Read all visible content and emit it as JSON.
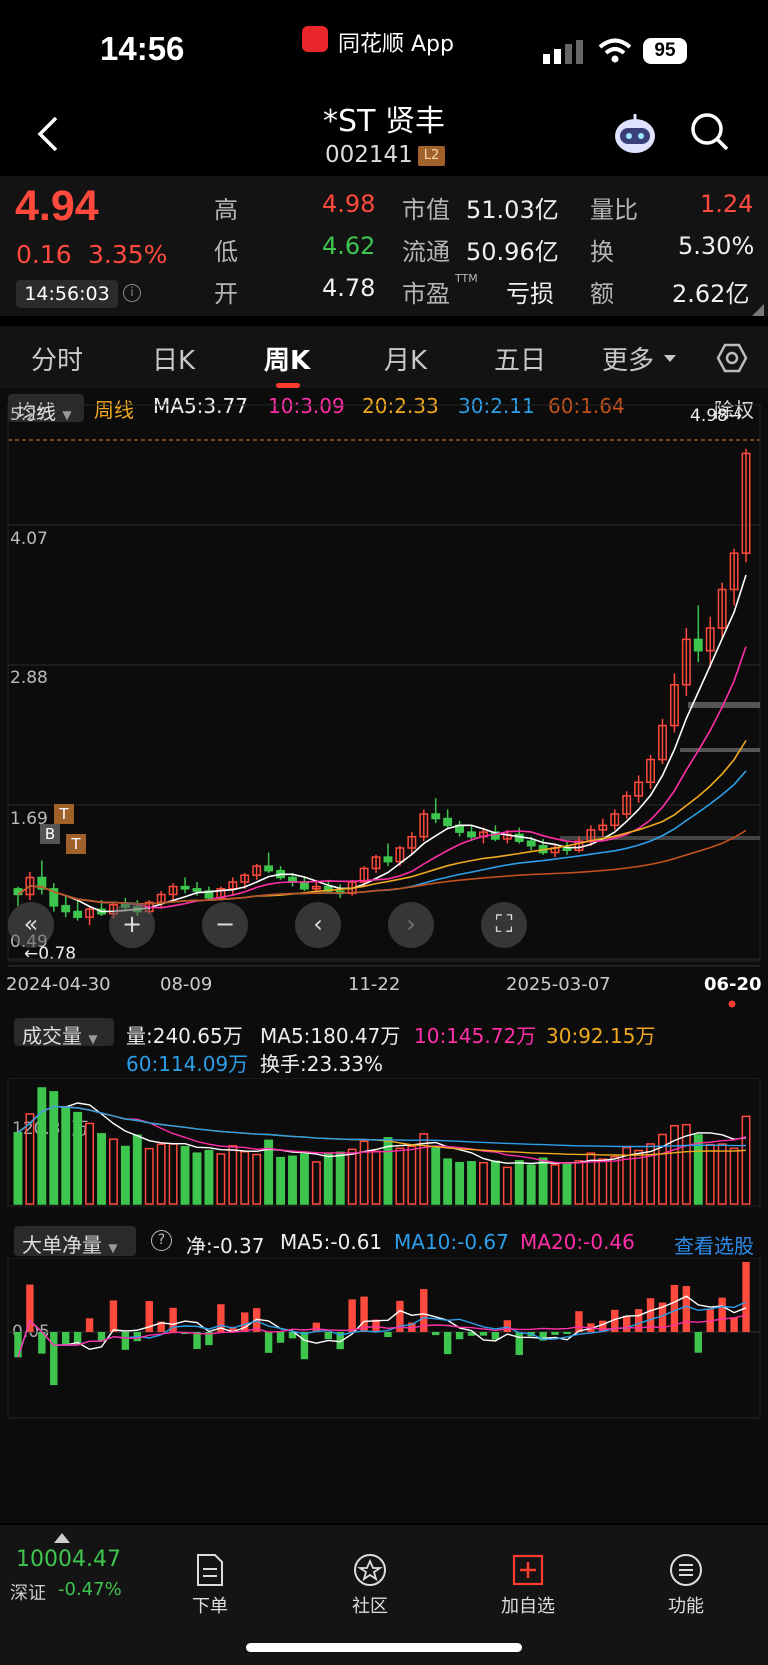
{
  "status": {
    "time": "14:56",
    "app": "同花顺 App",
    "battery": "95"
  },
  "nav": {
    "name": "*ST 贤丰",
    "code": "002141",
    "level": "L2"
  },
  "quote": {
    "price": "4.94",
    "change": "0.16",
    "pct": "3.35%",
    "time": "14:56:03",
    "hi_l": "高",
    "hi": "4.98",
    "lo_l": "低",
    "lo": "4.62",
    "op_l": "开",
    "op": "4.78",
    "mv_l": "市值",
    "mv": "51.03亿",
    "fl_l": "流通",
    "fl": "50.96亿",
    "pe_l": "市盈",
    "pe_sup": "TTM",
    "pe": "亏损",
    "vr_l": "量比",
    "vr": "1.24",
    "tr_l": "换",
    "tr": "5.30%",
    "am_l": "额",
    "am": "2.62亿"
  },
  "tabs": [
    "分时",
    "日K",
    "周K",
    "月K",
    "五日",
    "更多"
  ],
  "legend": {
    "type": "均线",
    "period": "周线",
    "ma5": "MA5:3.77",
    "ma10": "10:3.09",
    "ma20": "20:2.33",
    "ma30": "30:2.11",
    "ma60": "60:1.64",
    "adj": "除权"
  },
  "price_axis": {
    "top": "5.27",
    "mid1": "4.07",
    "mid2": "2.88",
    "mid3": "1.69",
    "bottom": "0.49",
    "max_mark": "4.98→",
    "min_mark": "←0.78"
  },
  "dates": [
    "2024-04-30",
    "08-09",
    "11-22",
    "2025-03-07",
    "06-20"
  ],
  "vol_legend": {
    "label": "成交量",
    "vol": "量:240.65万",
    "ma5": "MA5:180.47万",
    "ma10": "10:145.72万",
    "ma30": "30:92.15万",
    "ma60": "60:114.09万",
    "hs": "换手:23.33%",
    "axis": "120.33万"
  },
  "flow_legend": {
    "label": "大单净量",
    "net": "净:-0.37",
    "ma5": "MA5:-0.61",
    "ma10": "MA10:-0.67",
    "ma20": "MA20:-0.46",
    "link": "查看选股",
    "axis": "0.05"
  },
  "markers": {
    "b": "B",
    "t": "T"
  },
  "bottom": {
    "index_val": "10004.47",
    "index_name": "深证",
    "index_pct": "-0.47%",
    "b1": "下单",
    "b2": "社区",
    "b3": "加自选",
    "b4": "功能"
  },
  "colors": {
    "up": "#ff4a3d",
    "down": "#3ec54d",
    "ma5": "#ffffff",
    "ma10": "#ff2fa8",
    "ma20": "#f0a91f",
    "ma30": "#2d9ee8",
    "ma60": "#c4521c"
  },
  "chart_data": {
    "type": "candlestick",
    "title": "*ST贤丰 周K",
    "ylim": [
      0.49,
      5.27
    ],
    "x": [
      "2024-04-30",
      "08-09",
      "11-22",
      "2025-03-07",
      "06-20"
    ],
    "series": [
      {
        "name": "MA5",
        "value": 3.77
      },
      {
        "name": "10",
        "value": 3.09
      },
      {
        "name": "20",
        "value": 2.33
      },
      {
        "name": "30",
        "value": 2.11
      },
      {
        "name": "60",
        "value": 1.64
      }
    ],
    "candles": [
      [
        1.1,
        1.12,
        0.95,
        1.05
      ],
      [
        1.05,
        1.25,
        1.0,
        1.2
      ],
      [
        1.2,
        1.35,
        1.05,
        1.1
      ],
      [
        1.1,
        1.15,
        0.9,
        0.95
      ],
      [
        0.95,
        1.05,
        0.85,
        0.9
      ],
      [
        0.9,
        1.0,
        0.82,
        0.85
      ],
      [
        0.85,
        0.95,
        0.78,
        0.92
      ],
      [
        0.92,
        1.0,
        0.86,
        0.88
      ],
      [
        0.88,
        0.98,
        0.84,
        0.96
      ],
      [
        0.96,
        1.02,
        0.9,
        0.94
      ],
      [
        0.94,
        1.0,
        0.86,
        0.9
      ],
      [
        0.9,
        1.0,
        0.88,
        0.98
      ],
      [
        0.98,
        1.08,
        0.94,
        1.05
      ],
      [
        1.05,
        1.15,
        1.0,
        1.12
      ],
      [
        1.12,
        1.2,
        1.06,
        1.1
      ],
      [
        1.1,
        1.16,
        1.04,
        1.08
      ],
      [
        1.08,
        1.12,
        1.0,
        1.02
      ],
      [
        1.02,
        1.12,
        1.0,
        1.1
      ],
      [
        1.1,
        1.2,
        1.05,
        1.16
      ],
      [
        1.16,
        1.24,
        1.1,
        1.22
      ],
      [
        1.22,
        1.32,
        1.18,
        1.3
      ],
      [
        1.3,
        1.42,
        1.24,
        1.26
      ],
      [
        1.26,
        1.3,
        1.18,
        1.2
      ],
      [
        1.2,
        1.24,
        1.12,
        1.16
      ],
      [
        1.16,
        1.2,
        1.08,
        1.1
      ],
      [
        1.1,
        1.16,
        1.06,
        1.12
      ],
      [
        1.12,
        1.18,
        1.06,
        1.08
      ],
      [
        1.08,
        1.14,
        1.02,
        1.06
      ],
      [
        1.06,
        1.18,
        1.04,
        1.16
      ],
      [
        1.16,
        1.3,
        1.12,
        1.28
      ],
      [
        1.28,
        1.4,
        1.24,
        1.38
      ],
      [
        1.38,
        1.5,
        1.3,
        1.34
      ],
      [
        1.34,
        1.48,
        1.3,
        1.46
      ],
      [
        1.46,
        1.6,
        1.4,
        1.56
      ],
      [
        1.56,
        1.8,
        1.52,
        1.76
      ],
      [
        1.76,
        1.9,
        1.68,
        1.72
      ],
      [
        1.72,
        1.8,
        1.64,
        1.66
      ],
      [
        1.66,
        1.7,
        1.56,
        1.6
      ],
      [
        1.6,
        1.66,
        1.52,
        1.56
      ],
      [
        1.56,
        1.64,
        1.5,
        1.6
      ],
      [
        1.6,
        1.66,
        1.52,
        1.54
      ],
      [
        1.54,
        1.62,
        1.5,
        1.58
      ],
      [
        1.58,
        1.64,
        1.5,
        1.52
      ],
      [
        1.52,
        1.56,
        1.44,
        1.48
      ],
      [
        1.48,
        1.54,
        1.4,
        1.42
      ],
      [
        1.42,
        1.5,
        1.38,
        1.46
      ],
      [
        1.46,
        1.52,
        1.4,
        1.44
      ],
      [
        1.44,
        1.56,
        1.42,
        1.52
      ],
      [
        1.52,
        1.66,
        1.48,
        1.62
      ],
      [
        1.62,
        1.72,
        1.56,
        1.66
      ],
      [
        1.66,
        1.8,
        1.62,
        1.76
      ],
      [
        1.76,
        1.96,
        1.72,
        1.92
      ],
      [
        1.92,
        2.1,
        1.86,
        2.04
      ],
      [
        2.04,
        2.28,
        1.98,
        2.24
      ],
      [
        2.24,
        2.6,
        2.2,
        2.54
      ],
      [
        2.54,
        3.0,
        2.48,
        2.9
      ],
      [
        2.9,
        3.4,
        2.8,
        3.3
      ],
      [
        3.3,
        3.6,
        3.1,
        3.2
      ],
      [
        3.2,
        3.5,
        3.05,
        3.4
      ],
      [
        3.4,
        3.8,
        3.3,
        3.74
      ],
      [
        3.74,
        4.1,
        3.6,
        4.06
      ],
      [
        4.06,
        4.98,
        3.98,
        4.94
      ]
    ],
    "volume_unit": "万"
  }
}
